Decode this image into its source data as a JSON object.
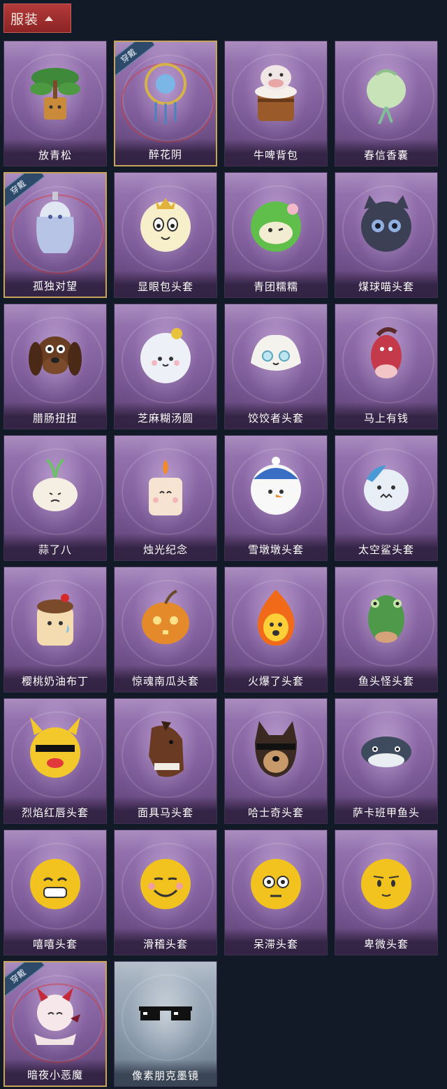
{
  "header": {
    "label": "服装",
    "toggle_icon": "chevron-up-icon"
  },
  "worn_badge": "穿戴",
  "items": [
    {
      "name": "放青松",
      "icon": "bonsai",
      "worn": false,
      "style": "purple"
    },
    {
      "name": "醉花阴",
      "icon": "dreamcatcher",
      "worn": true,
      "style": "purple"
    },
    {
      "name": "牛啤背包",
      "icon": "cow-barrel",
      "worn": false,
      "style": "purple"
    },
    {
      "name": "春信香囊",
      "icon": "sachet",
      "worn": false,
      "style": "purple"
    },
    {
      "name": "孤独对望",
      "icon": "doll-charm",
      "worn": true,
      "style": "purple"
    },
    {
      "name": "显眼包头套",
      "icon": "bulb-head",
      "worn": false,
      "style": "purple"
    },
    {
      "name": "青团糯糯",
      "icon": "green-dumpling",
      "worn": false,
      "style": "purple"
    },
    {
      "name": "煤球喵头套",
      "icon": "black-cat",
      "worn": false,
      "style": "purple"
    },
    {
      "name": "腊肠扭扭",
      "icon": "dachshund",
      "worn": false,
      "style": "purple"
    },
    {
      "name": "芝麻糊汤圆",
      "icon": "tangyuan",
      "worn": false,
      "style": "purple"
    },
    {
      "name": "饺饺者头套",
      "icon": "dumpling",
      "worn": false,
      "style": "purple"
    },
    {
      "name": "马上有钱",
      "icon": "horse-red",
      "worn": false,
      "style": "purple"
    },
    {
      "name": "蒜了八",
      "icon": "garlic",
      "worn": false,
      "style": "purple"
    },
    {
      "name": "烛光纪念",
      "icon": "candle",
      "worn": false,
      "style": "purple"
    },
    {
      "name": "雪墩墩头套",
      "icon": "snowman",
      "worn": false,
      "style": "purple"
    },
    {
      "name": "太空鲨头套",
      "icon": "shark",
      "worn": false,
      "style": "purple"
    },
    {
      "name": "樱桃奶油布丁",
      "icon": "pudding",
      "worn": false,
      "style": "purple"
    },
    {
      "name": "惊魂南瓜头套",
      "icon": "pumpkin",
      "worn": false,
      "style": "purple"
    },
    {
      "name": "火爆了头套",
      "icon": "fire",
      "worn": false,
      "style": "purple"
    },
    {
      "name": "鱼头怪头套",
      "icon": "fish-head",
      "worn": false,
      "style": "purple"
    },
    {
      "name": "烈焰红唇头套",
      "icon": "pikachu-lips",
      "worn": false,
      "style": "purple"
    },
    {
      "name": "面具马头套",
      "icon": "horse-mask",
      "worn": false,
      "style": "purple"
    },
    {
      "name": "哈士奇头套",
      "icon": "husky",
      "worn": false,
      "style": "purple"
    },
    {
      "name": "萨卡班甲鱼头",
      "icon": "sacabambaspis",
      "worn": false,
      "style": "purple"
    },
    {
      "name": "嘻嘻头套",
      "icon": "emoji-grin",
      "worn": false,
      "style": "purple"
    },
    {
      "name": "滑稽头套",
      "icon": "emoji-smirk",
      "worn": false,
      "style": "purple"
    },
    {
      "name": "呆滞头套",
      "icon": "emoji-stare",
      "worn": false,
      "style": "purple"
    },
    {
      "name": "卑微头套",
      "icon": "emoji-timid",
      "worn": false,
      "style": "purple"
    },
    {
      "name": "暗夜小恶魔",
      "icon": "devil",
      "worn": true,
      "style": "purple"
    },
    {
      "name": "像素朋克墨镜",
      "icon": "pixel-sunglasses",
      "worn": false,
      "style": "gray"
    }
  ]
}
